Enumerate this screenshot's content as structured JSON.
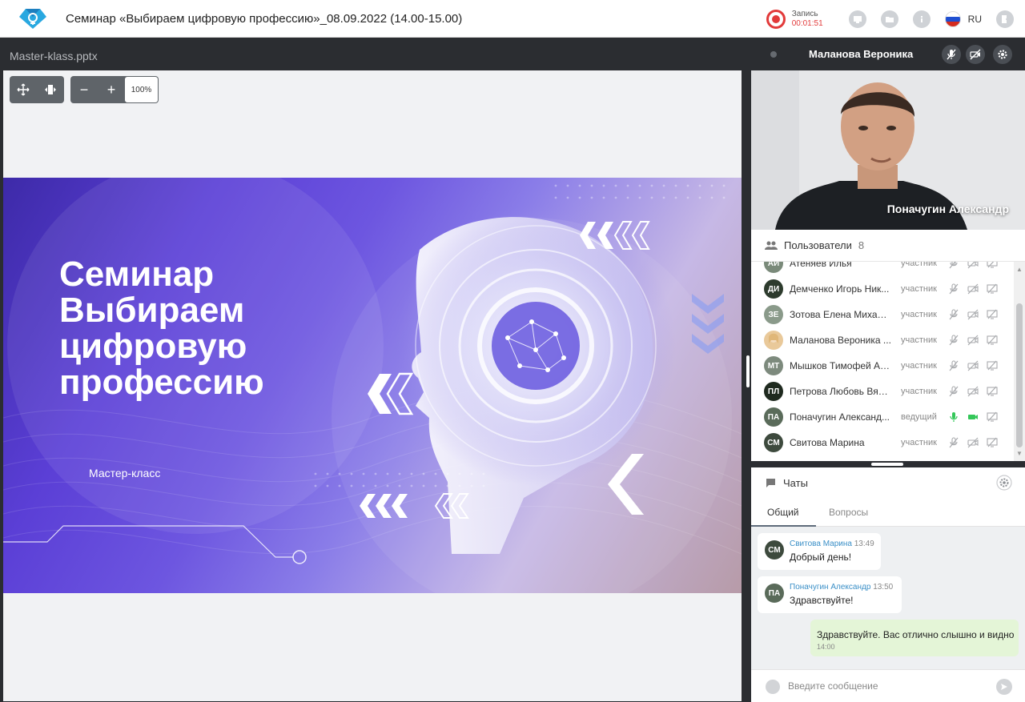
{
  "header": {
    "title": "Семинар «Выбираем цифровую профессию»_08.09.2022 (14.00-15.00)",
    "recording_label": "Запись",
    "recording_time": "00:01:51",
    "language": "RU"
  },
  "presentation": {
    "file_name": "Master-klass.pptx",
    "zoom": "100%",
    "slide_title": "Семинар Выбираем цифровую профессию",
    "slide_subtitle": "Мастер-класс"
  },
  "video": {
    "header_name": "Маланова Вероника",
    "speaker_name": "Поначугин Александр"
  },
  "users": {
    "title": "Пользователи",
    "count": "8",
    "items": [
      {
        "initials": "АИ",
        "name": "Атеняев Илья",
        "role": "участник",
        "color": "#7a8a7a",
        "mic": "off",
        "cam": "off"
      },
      {
        "initials": "ДИ",
        "name": "Демченко Игорь Ник...",
        "role": "участник",
        "color": "#2d3b2d",
        "mic": "off",
        "cam": "off"
      },
      {
        "initials": "ЗЕ",
        "name": "Зотова Елена Михайл...",
        "role": "участник",
        "color": "#8a9a8a",
        "mic": "off",
        "cam": "off"
      },
      {
        "initials": "",
        "name": "Маланова Вероника ...",
        "role": "участник",
        "color": "#e9c99a",
        "mic": "off",
        "cam": "off"
      },
      {
        "initials": "МТ",
        "name": "Мышков Тимофей Ал...",
        "role": "участник",
        "color": "#7d8a7d",
        "mic": "off",
        "cam": "off"
      },
      {
        "initials": "ПЛ",
        "name": "Петрова Любовь Вяче...",
        "role": "участник",
        "color": "#1f2a1f",
        "mic": "off",
        "cam": "off"
      },
      {
        "initials": "ПА",
        "name": "Поначугин Александ...",
        "role": "ведущий",
        "color": "#5a6b5a",
        "mic": "on",
        "cam": "on"
      },
      {
        "initials": "СМ",
        "name": "Свитова Марина",
        "role": "участник",
        "color": "#3d4a3d",
        "mic": "off",
        "cam": "off"
      }
    ]
  },
  "chat": {
    "title": "Чаты",
    "tabs": [
      "Общий",
      "Вопросы"
    ],
    "messages": [
      {
        "initials": "СМ",
        "author": "Свитова Марина",
        "time": "13:49",
        "text": "Добрый день!",
        "color": "#3d4a3d"
      },
      {
        "initials": "ПА",
        "author": "Поначугин Александр",
        "time": "13:50",
        "text": "Здравствуйте!",
        "color": "#5a6b5a"
      }
    ],
    "own_message": {
      "text": "Здравствуйте. Вас отлично слышно и видно",
      "time": "14:00"
    },
    "input_placeholder": "Введите сообщение"
  },
  "colors": {
    "accent": "#3a8fc7",
    "record": "#e23a3a",
    "mic_on": "#34c759",
    "own_bubble": "#e4f5d7"
  }
}
